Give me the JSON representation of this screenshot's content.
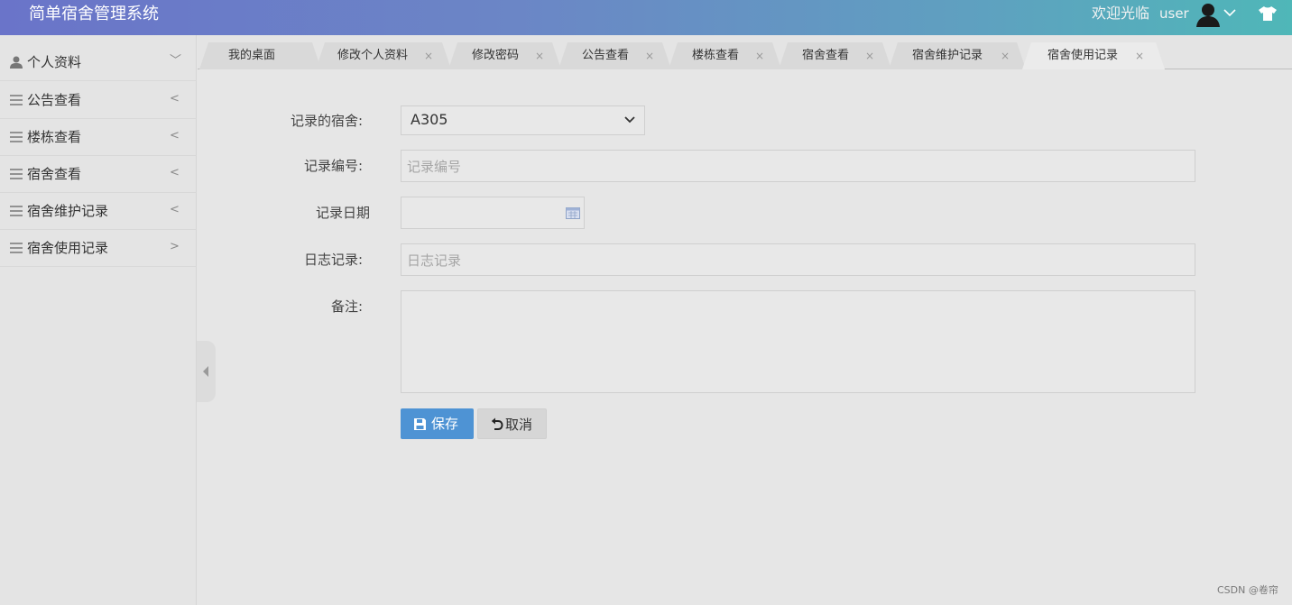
{
  "header": {
    "app_title": "简单宿舍管理系统",
    "welcome": "欢迎光临",
    "username": "user"
  },
  "sidebar": {
    "items": [
      {
        "label": "个人资料",
        "icon": "user-icon",
        "arrow": "﹀"
      },
      {
        "label": "公告查看",
        "icon": "menu-icon",
        "arrow": "<"
      },
      {
        "label": "楼栋查看",
        "icon": "menu-icon",
        "arrow": "<"
      },
      {
        "label": "宿舍查看",
        "icon": "menu-icon",
        "arrow": "<"
      },
      {
        "label": "宿舍维护记录",
        "icon": "menu-icon",
        "arrow": "<"
      },
      {
        "label": "宿舍使用记录",
        "icon": "menu-icon",
        "arrow": ">"
      }
    ]
  },
  "tabs": [
    {
      "label": "我的桌面",
      "closable": false
    },
    {
      "label": "修改个人资料",
      "closable": true
    },
    {
      "label": "修改密码",
      "closable": true
    },
    {
      "label": "公告查看",
      "closable": true
    },
    {
      "label": "楼栋查看",
      "closable": true
    },
    {
      "label": "宿舍查看",
      "closable": true
    },
    {
      "label": "宿舍维护记录",
      "closable": true
    },
    {
      "label": "宿舍使用记录",
      "closable": true,
      "active": true
    }
  ],
  "tab_close_glyph": "×",
  "form": {
    "dorm_label": "记录的宿舍:",
    "dorm_value": "A305",
    "record_no_label": "记录编号:",
    "record_no_placeholder": "记录编号",
    "record_date_label": "记录日期",
    "log_label": "日志记录:",
    "log_placeholder": "日志记录",
    "remark_label": "备注:"
  },
  "buttons": {
    "save": "保存",
    "cancel": "取消"
  },
  "watermark": "CSDN @卷帘",
  "colors": {
    "header_start": "#6a74c9",
    "header_end": "#4fb7b8",
    "save_button": "#4e93d4"
  }
}
